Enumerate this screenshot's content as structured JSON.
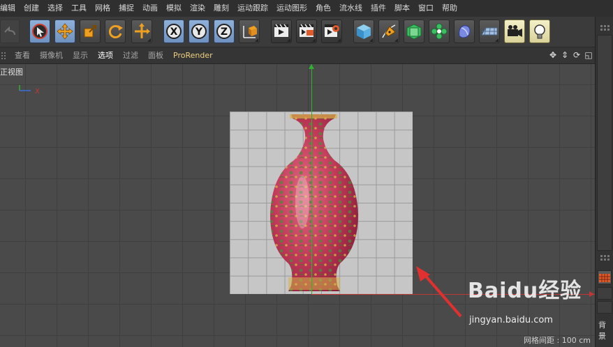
{
  "menubar": {
    "items": [
      "编辑",
      "创建",
      "选择",
      "工具",
      "网格",
      "捕捉",
      "动画",
      "模拟",
      "渲染",
      "雕刻",
      "运动跟踪",
      "运动图形",
      "角色",
      "流水线",
      "插件",
      "脚本",
      "窗口",
      "帮助"
    ]
  },
  "toolbar": {
    "tools": [
      {
        "name": "undo-icon",
        "style": "disabled"
      },
      {
        "name": "live-selection-icon",
        "style": "active"
      },
      {
        "name": "move-icon",
        "style": "active"
      },
      {
        "name": "scale-icon",
        "style": "gray"
      },
      {
        "name": "rotate-icon",
        "style": "gray"
      },
      {
        "name": "recent-tools-icon",
        "style": "gray"
      },
      {
        "name": "x-axis-lock-icon",
        "style": "active"
      },
      {
        "name": "y-axis-lock-icon",
        "style": "active"
      },
      {
        "name": "z-axis-lock-icon",
        "style": "active"
      },
      {
        "name": "coordinate-system-icon",
        "style": "gray"
      },
      {
        "name": "render-view-icon",
        "style": "dark"
      },
      {
        "name": "render-to-picture-viewer-icon",
        "style": "dark"
      },
      {
        "name": "render-settings-icon",
        "style": "dark"
      },
      {
        "name": "cube-icon",
        "style": "gray"
      },
      {
        "name": "pen-spline-icon",
        "style": "gray"
      },
      {
        "name": "subdivision-surface-icon",
        "style": "gray"
      },
      {
        "name": "cloner-icon",
        "style": "gray"
      },
      {
        "name": "deformer-icon",
        "style": "gray"
      },
      {
        "name": "floor-icon",
        "style": "gray"
      },
      {
        "name": "camera-icon",
        "style": "yellow"
      },
      {
        "name": "light-icon",
        "style": "yellow"
      }
    ]
  },
  "viewmenu": {
    "items": [
      "查看",
      "摄像机",
      "显示",
      "选项",
      "过滤",
      "面板",
      "ProRender"
    ],
    "active": "选项"
  },
  "viewport": {
    "view_name": "正视图",
    "axis_x_label": "X",
    "grid_spacing": "网格间距 : 100 cm"
  },
  "dock": {
    "label": "背景"
  },
  "watermark": {
    "logo": "Baidu经验",
    "url": "jingyan.baidu.com"
  },
  "colors": {
    "accent_active": "#7fa3d0",
    "axis_x": "#c23636",
    "axis_y": "#2fb02f",
    "annotation": "#e03030",
    "vase_body": "#c23a5a"
  }
}
